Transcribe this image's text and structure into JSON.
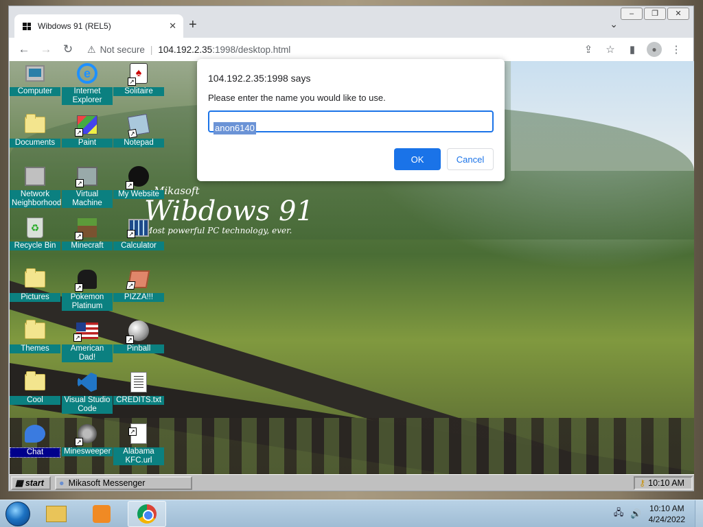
{
  "browser": {
    "tab_title": "Wibdows 91 (REL5)",
    "security_label": "Not secure",
    "url_host": "104.192.2.35",
    "url_path": ":1998/desktop.html"
  },
  "desktop": {
    "brand_small": "Mikasoft",
    "brand_title": "Wibdows 91",
    "brand_tagline": "Most powerful PC technology, ever.",
    "icons": [
      {
        "label": "Computer"
      },
      {
        "label": "Internet Explorer"
      },
      {
        "label": "Solitaire"
      },
      {
        "label": "Documents"
      },
      {
        "label": "Paint"
      },
      {
        "label": "Notepad"
      },
      {
        "label": "Network Neighborhood"
      },
      {
        "label": "Virtual Machine"
      },
      {
        "label": "My Website"
      },
      {
        "label": "Recycle Bin"
      },
      {
        "label": "Minecraft"
      },
      {
        "label": "Calculator"
      },
      {
        "label": "Pictures"
      },
      {
        "label": "Pokemon Platinum"
      },
      {
        "label": "PIZZA!!!"
      },
      {
        "label": "Themes"
      },
      {
        "label": "American Dad!"
      },
      {
        "label": "Pinball"
      },
      {
        "label": "Cool"
      },
      {
        "label": "Visual Studio Code"
      },
      {
        "label": "CREDITS.txt"
      },
      {
        "label": "Chat"
      },
      {
        "label": "Minesweeper"
      },
      {
        "label": "Alabama KFC.url"
      }
    ],
    "taskbar": {
      "start_label": "start",
      "window_button": "Mikasoft Messenger",
      "clock": "10:10 AM"
    }
  },
  "dialog": {
    "title": "104.192.2.35:1998 says",
    "message": "Please enter the name you would like to use.",
    "input_value": "anon6140",
    "ok_label": "OK",
    "cancel_label": "Cancel"
  },
  "os_taskbar": {
    "time": "10:10 AM",
    "date": "4/24/2022"
  }
}
